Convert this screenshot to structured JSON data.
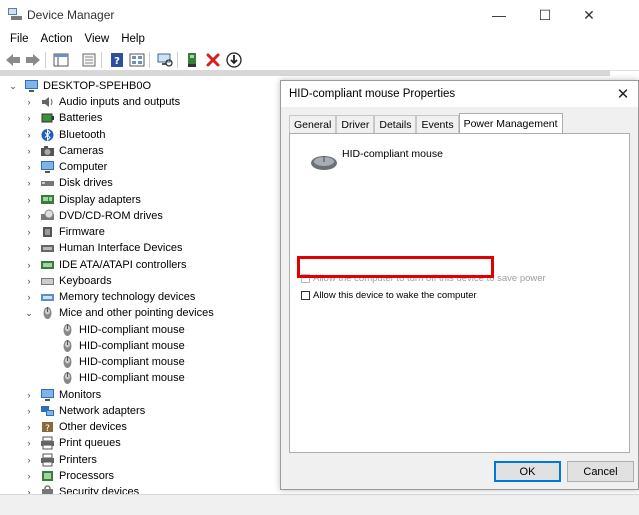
{
  "window": {
    "title": "Device Manager",
    "controls": {
      "minimize": "—",
      "maximize": "☐",
      "close": "✕"
    }
  },
  "menubar": [
    "File",
    "Action",
    "View",
    "Help"
  ],
  "toolbar": {
    "buttons": [
      "back-arrow-icon",
      "forward-arrow-icon",
      "properties-icon",
      "update-driver-icon",
      "help-icon",
      "show-hidden-icon",
      "scan-hardware-icon",
      "add-driver-icon",
      "uninstall-icon",
      "download-icon"
    ]
  },
  "tree": {
    "root": "DESKTOP-SPEHB0O",
    "categories": [
      {
        "label": "Audio inputs and outputs",
        "icon": "speaker-icon"
      },
      {
        "label": "Batteries",
        "icon": "battery-icon"
      },
      {
        "label": "Bluetooth",
        "icon": "bluetooth-icon"
      },
      {
        "label": "Cameras",
        "icon": "camera-icon"
      },
      {
        "label": "Computer",
        "icon": "monitor-icon"
      },
      {
        "label": "Disk drives",
        "icon": "disk-icon"
      },
      {
        "label": "Display adapters",
        "icon": "display-adapter-icon"
      },
      {
        "label": "DVD/CD-ROM drives",
        "icon": "dvd-icon"
      },
      {
        "label": "Firmware",
        "icon": "chip-icon"
      },
      {
        "label": "Human Interface Devices",
        "icon": "hid-icon"
      },
      {
        "label": "IDE ATA/ATAPI controllers",
        "icon": "ide-icon"
      },
      {
        "label": "Keyboards",
        "icon": "keyboard-icon"
      },
      {
        "label": "Memory technology devices",
        "icon": "memory-icon"
      },
      {
        "label": "Mice and other pointing devices",
        "icon": "mouse-icon"
      },
      {
        "label": "HID-compliant mouse",
        "icon": "mouse-icon"
      },
      {
        "label": "HID-compliant mouse",
        "icon": "mouse-icon"
      },
      {
        "label": "HID-compliant mouse",
        "icon": "mouse-icon"
      },
      {
        "label": "HID-compliant mouse",
        "icon": "mouse-icon"
      },
      {
        "label": "Monitors",
        "icon": "monitor-icon"
      },
      {
        "label": "Network adapters",
        "icon": "network-icon"
      },
      {
        "label": "Other devices",
        "icon": "unknown-device-icon"
      },
      {
        "label": "Print queues",
        "icon": "printer-icon"
      },
      {
        "label": "Printers",
        "icon": "printer-icon"
      },
      {
        "label": "Processors",
        "icon": "processor-icon"
      },
      {
        "label": "Security devices",
        "icon": "security-icon"
      }
    ]
  },
  "dialog": {
    "title": "HID-compliant mouse Properties",
    "close": "✕",
    "tabs": [
      "General",
      "Driver",
      "Details",
      "Events",
      "Power Management"
    ],
    "active_tab": "Power Management",
    "device_name": "HID-compliant mouse",
    "options": {
      "allow_turn_off": "Allow the computer to turn off this device to save power",
      "allow_wake": "Allow this device to wake the computer"
    },
    "ok": "OK",
    "cancel": "Cancel"
  },
  "colors": {
    "highlight": "#e00000",
    "accent": "#0078d7"
  }
}
